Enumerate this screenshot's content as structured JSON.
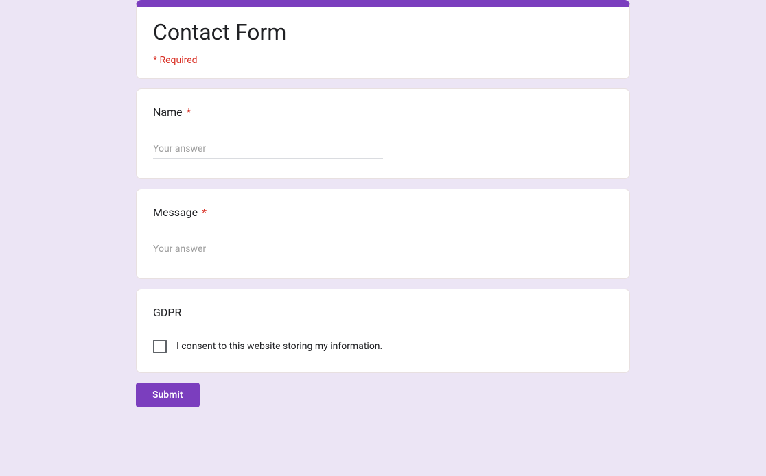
{
  "header": {
    "title": "Contact Form",
    "required_text": "* Required"
  },
  "fields": {
    "name": {
      "label": "Name",
      "placeholder": "Your answer"
    },
    "message": {
      "label": "Message",
      "placeholder": "Your answer"
    },
    "gdpr": {
      "label": "GDPR",
      "option": "I consent to this website storing my information."
    }
  },
  "actions": {
    "submit": "Submit"
  }
}
